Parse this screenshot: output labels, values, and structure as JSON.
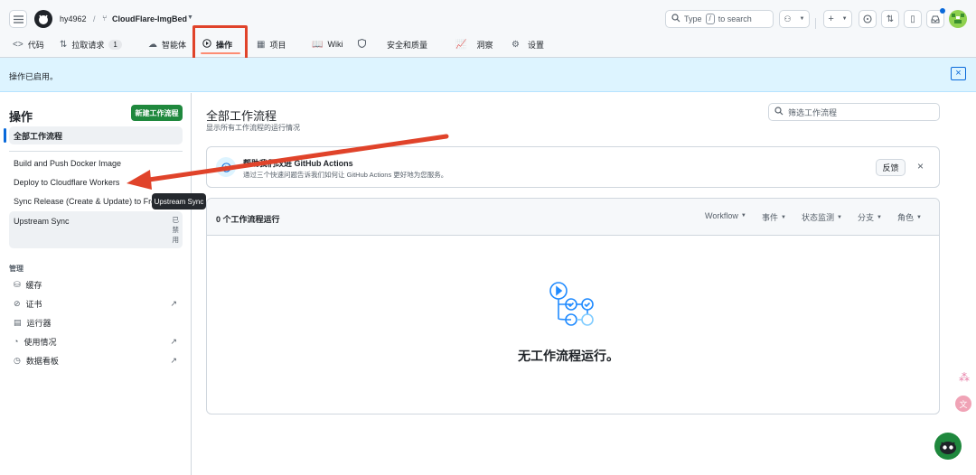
{
  "header": {
    "owner": "hy4962",
    "separator": "/",
    "repo": "CloudFlare-ImgBed",
    "search_placeholder_pre": "Type",
    "search_key": "/",
    "search_placeholder_post": "to search"
  },
  "tabs": [
    {
      "label": "代码",
      "icon": "code-icon"
    },
    {
      "label": "拉取请求",
      "icon": "pull-request-icon",
      "count": "1"
    },
    {
      "label": "智能体",
      "icon": "agents-icon"
    },
    {
      "label": "操作",
      "icon": "actions-icon",
      "selected": true
    },
    {
      "label": "项目",
      "icon": "projects-icon"
    },
    {
      "label": "Wiki",
      "icon": "wiki-icon"
    },
    {
      "label": "安全和质量",
      "icon": "shield-icon"
    },
    {
      "label": "洞察",
      "icon": "insights-icon"
    },
    {
      "label": "设置",
      "icon": "gear-icon"
    }
  ],
  "flash": {
    "message": "操作已启用。",
    "close": "×"
  },
  "sidebar": {
    "title": "操作",
    "new_workflow": "新建工作流程",
    "all_workflows": "全部工作流程",
    "workflows": [
      "Build and Push Docker Image",
      "Deploy to Cloudflare Workers",
      "Sync Release (Create & Update) to From"
    ],
    "upstream": {
      "label": "Upstream Sync",
      "badge": "已\n禁\n用"
    },
    "tooltip": "Upstream Sync",
    "management_heading": "管理",
    "management": [
      {
        "label": "缓存",
        "icon": "cache-icon",
        "external": false
      },
      {
        "label": "证书",
        "icon": "attestation-icon",
        "external": true
      },
      {
        "label": "运行器",
        "icon": "runner-icon",
        "external": false
      },
      {
        "label": "使用情况",
        "icon": "usage-icon",
        "external": true
      },
      {
        "label": "数据看板",
        "icon": "dashboard-icon",
        "external": true
      }
    ]
  },
  "main": {
    "title": "全部工作流程",
    "subtitle": "显示所有工作流程的运行情况",
    "filter_placeholder": "筛选工作流程",
    "help": {
      "title": "帮助我们改进 GitHub Actions",
      "body": "通过三个快速问题告诉我们如何让 GitHub Actions 更好地为您服务。",
      "button": "反馈",
      "close": "×"
    },
    "runs": {
      "count_label": "0 个工作流程运行",
      "filters": [
        "Workflow",
        "事件",
        "状态监测",
        "分支",
        "角色"
      ],
      "empty": "无工作流程运行。"
    }
  },
  "colors": {
    "accent_red": "#e0432a",
    "primary_green": "#1f883d",
    "link_blue": "#0969da"
  }
}
